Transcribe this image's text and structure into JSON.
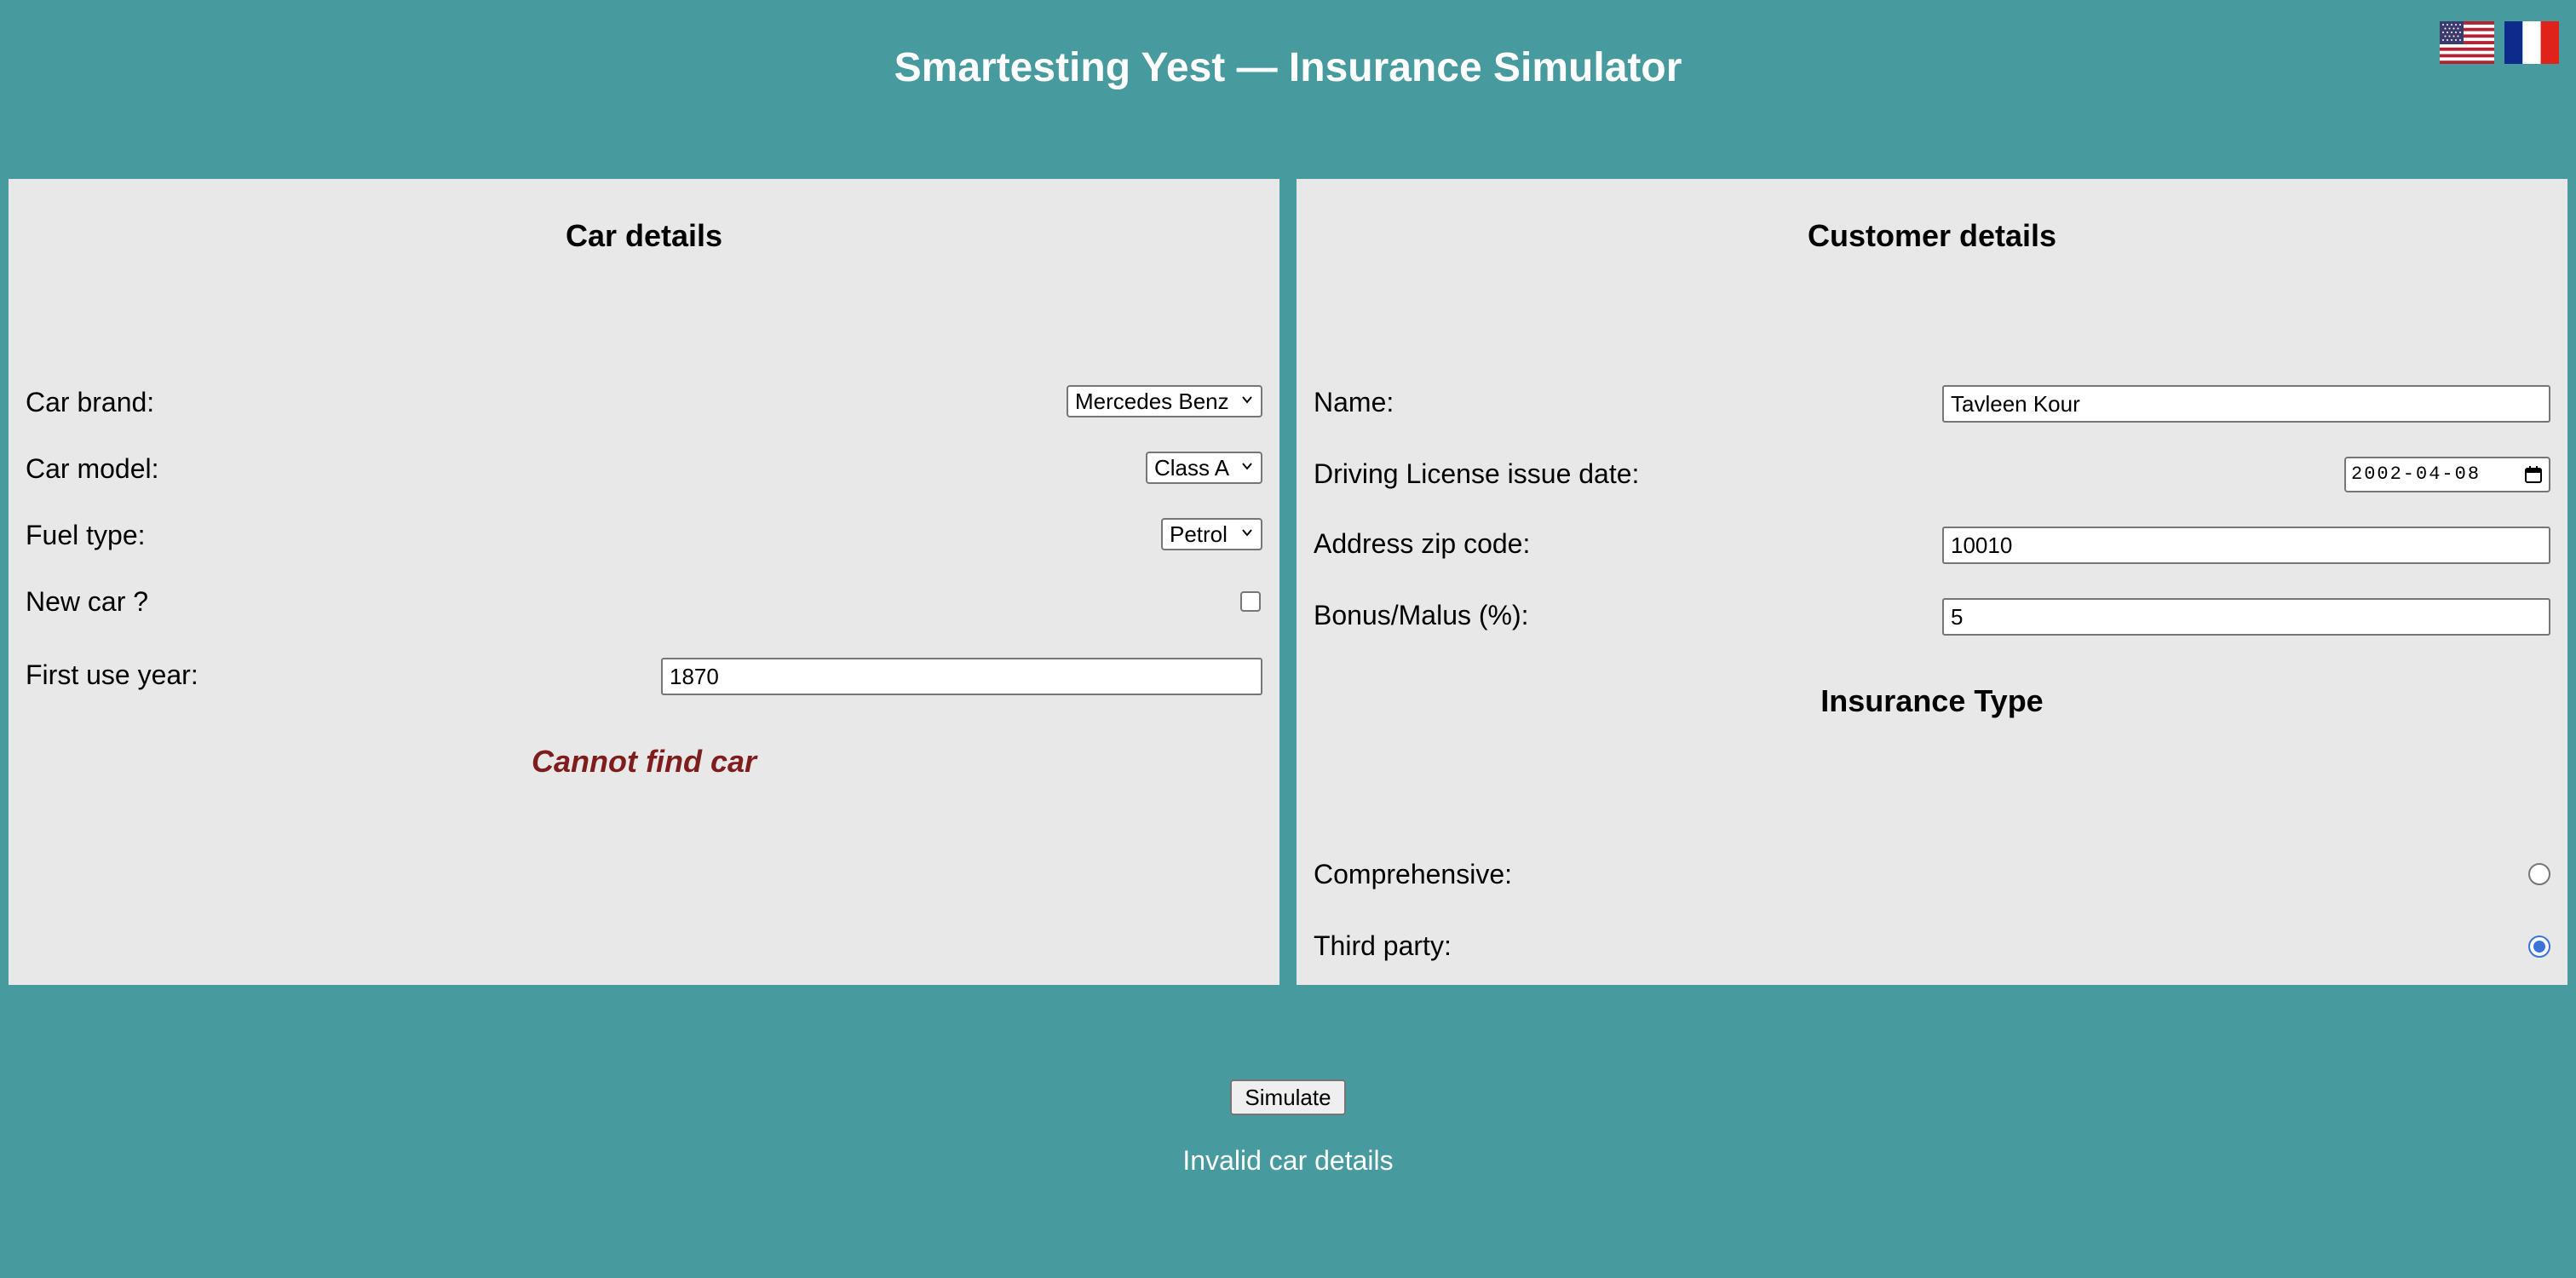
{
  "header": {
    "title": "Smartesting Yest — Insurance Simulator",
    "languages": [
      {
        "icon": "us-flag-icon",
        "code": "en"
      },
      {
        "icon": "france-flag-icon",
        "code": "fr"
      }
    ]
  },
  "car_details": {
    "title": "Car details",
    "brand": {
      "label": "Car brand:",
      "value": "Mercedes Benz"
    },
    "model": {
      "label": "Car model:",
      "value": "Class A"
    },
    "fuel": {
      "label": "Fuel type:",
      "value": "Petrol"
    },
    "new_car": {
      "label": "New car ?",
      "checked": false
    },
    "first_use_year": {
      "label": "First use year:",
      "value": "1870"
    },
    "error": "Cannot find car"
  },
  "customer_details": {
    "title": "Customer details",
    "name": {
      "label": "Name:",
      "value": "Tavleen Kour"
    },
    "license_date": {
      "label": "Driving License issue date:",
      "value": "2002-04-08"
    },
    "zip": {
      "label": "Address zip code:",
      "value": "10010"
    },
    "bonus_malus": {
      "label": "Bonus/Malus (%):",
      "value": "5"
    }
  },
  "insurance_type": {
    "title": "Insurance Type",
    "comprehensive": {
      "label": "Comprehensive:",
      "selected": false
    },
    "third_party": {
      "label": "Third party:",
      "selected": true
    }
  },
  "actions": {
    "simulate_label": "Simulate",
    "status": "Invalid car details"
  },
  "colors": {
    "background": "#479b9f",
    "panel": "#e8e8e8",
    "error": "#7f1d1d",
    "radio_accent": "#3b73d9"
  }
}
